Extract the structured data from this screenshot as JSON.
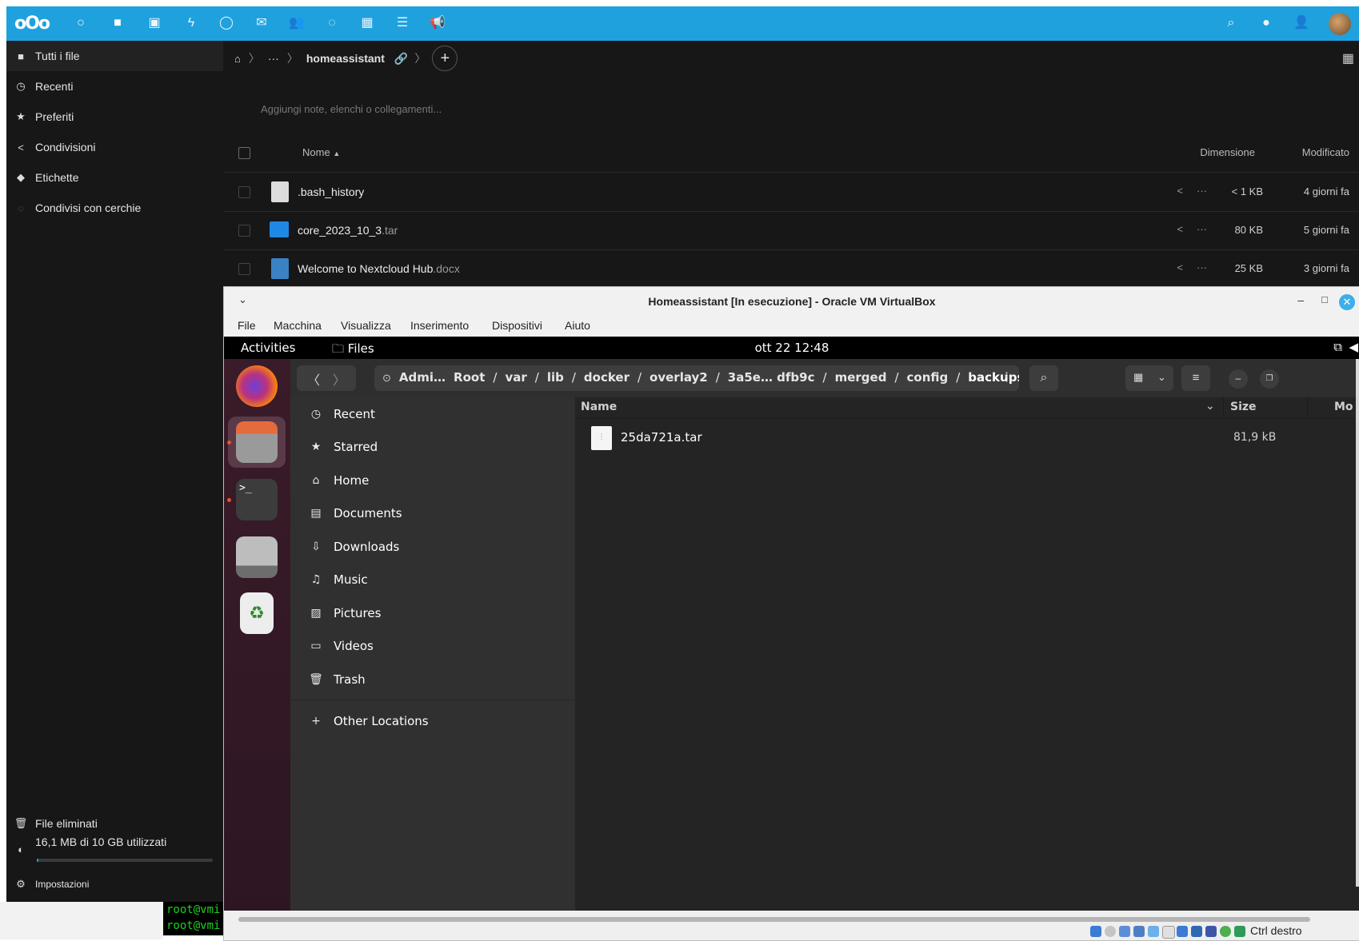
{
  "nextcloud": {
    "topbar": {
      "apps": [
        "dashboard-icon",
        "files-icon",
        "photos-icon",
        "activity-icon",
        "talk-icon",
        "mail-icon",
        "contacts-icon",
        "circles-icon",
        "calendar-icon",
        "deck-icon",
        "announcements-icon"
      ],
      "accent": "#1fa1de"
    },
    "sidebar": {
      "items": [
        {
          "label": "Tutti i file",
          "icon": "folder-icon"
        },
        {
          "label": "Recenti",
          "icon": "clock-icon"
        },
        {
          "label": "Preferiti",
          "icon": "star-icon"
        },
        {
          "label": "Condivisioni",
          "icon": "share-icon"
        },
        {
          "label": "Etichette",
          "icon": "tag-icon"
        },
        {
          "label": "Condivisi con cerchie",
          "icon": "circles-icon"
        }
      ],
      "deleted": "File eliminati",
      "quota": "16,1 MB di 10 GB utilizzati",
      "quota_fraction": 0.0016,
      "settings": "Impostazioni"
    },
    "breadcrumb": {
      "home_icon": "home-icon",
      "ellipsis": "···",
      "folder": "homeassistant"
    },
    "notes_placeholder": "Aggiungi note, elenchi o collegamenti...",
    "table": {
      "col_name": "Nome",
      "col_size": "Dimensione",
      "col_modified": "Modificato",
      "rows": [
        {
          "name": ".bash_history",
          "ext": "",
          "size": "< 1 KB",
          "modified": "4 giorni fa",
          "dots": "···"
        },
        {
          "name": "core_2023_10_3",
          "ext": ".tar",
          "size": "80 KB",
          "modified": "5 giorni fa",
          "dots": "···"
        },
        {
          "name": "Welcome to Nextcloud Hub",
          "ext": ".docx",
          "size": "25 KB",
          "modified": "3 giorni fa",
          "dots": "···"
        }
      ]
    }
  },
  "terminal": {
    "line1": "root@vmi",
    "line2": "root@vmi"
  },
  "virtualbox": {
    "title": "Homeassistant [In esecuzione] - Oracle VM VirtualBox",
    "menu": [
      "File",
      "Macchina",
      "Visualizza",
      "Inserimento",
      "Dispositivi",
      "Aiuto"
    ],
    "status_text": "Ctrl destro"
  },
  "gnome": {
    "activities": "Activities",
    "app_name": "Files",
    "clock": "ott 22  12:48"
  },
  "files_app": {
    "path": [
      "Admi…",
      "Root",
      "var",
      "lib",
      "docker",
      "overlay2",
      "3a5e… dfb9c",
      "merged",
      "config",
      "backups"
    ],
    "separator": "/",
    "places": [
      {
        "label": "Recent",
        "icon": "clock-icon"
      },
      {
        "label": "Starred",
        "icon": "star-icon"
      },
      {
        "label": "Home",
        "icon": "home-icon"
      },
      {
        "label": "Documents",
        "icon": "document-icon"
      },
      {
        "label": "Downloads",
        "icon": "download-icon"
      },
      {
        "label": "Music",
        "icon": "music-icon"
      },
      {
        "label": "Pictures",
        "icon": "picture-icon"
      },
      {
        "label": "Videos",
        "icon": "video-icon"
      },
      {
        "label": "Trash",
        "icon": "trash-icon"
      }
    ],
    "other_locations": "Other Locations",
    "columns": {
      "name": "Name",
      "size": "Size",
      "modified": "Mo"
    },
    "files": [
      {
        "name": "25da721a.tar",
        "size": "81,9 kB"
      }
    ]
  }
}
